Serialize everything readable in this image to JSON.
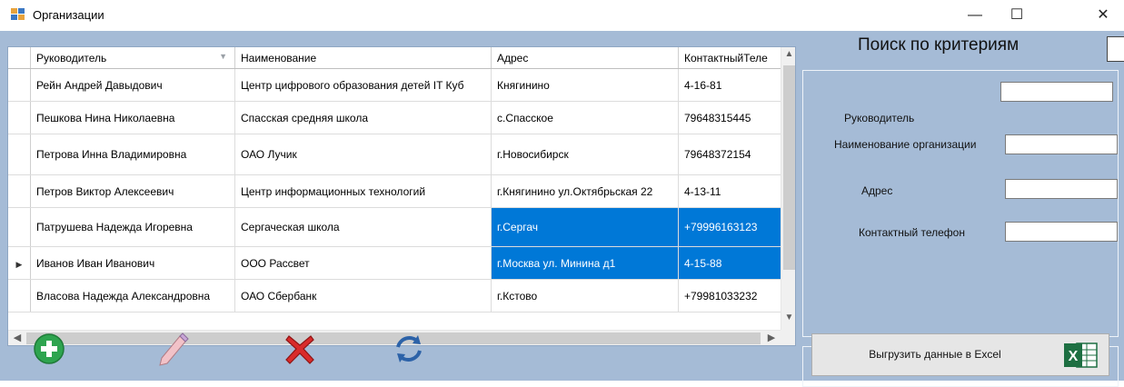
{
  "window": {
    "title": "Организации",
    "minimize": "—",
    "maximize": "☐",
    "close": "✕"
  },
  "grid": {
    "columns": [
      "Руководитель",
      "Наименование",
      "Адрес",
      "КонтактныйТеле"
    ],
    "rows": [
      {
        "cells": [
          "Рейн Андрей Давыдович",
          "Центр цифрового образования детей IT Куб",
          "Княгинино",
          "4-16-81"
        ],
        "current": false,
        "selected": false
      },
      {
        "cells": [
          "Пешкова Нина Николаевна",
          "Спасская средняя школа",
          "с.Спасское",
          "79648315445"
        ],
        "current": false,
        "selected": false
      },
      {
        "cells": [
          "Петрова Инна Владимировна",
          "ОАО Лучик",
          "г.Новосибирск",
          "79648372154"
        ],
        "current": false,
        "selected": false
      },
      {
        "cells": [
          "Петров Виктор Алексеевич",
          "Центр информационных технологий",
          "г.Княгинино ул.Октябрьская 22",
          "4-13-11"
        ],
        "current": false,
        "selected": false
      },
      {
        "cells": [
          "Патрушева Надежда Игоревна",
          "Сергаческая школа",
          "г.Сергач",
          "+79996163123"
        ],
        "current": false,
        "selected": true
      },
      {
        "cells": [
          "Иванов Иван Иванович",
          "ООО Рассвет",
          "г.Москва ул. Минина д1",
          "4-15-88"
        ],
        "current": true,
        "selected": true
      },
      {
        "cells": [
          "Власова Надежда Александровна",
          "ОАО Сбербанк",
          "г.Кстово",
          "+79981033232"
        ],
        "current": false,
        "selected": false
      }
    ]
  },
  "search": {
    "title": "Поиск по критериям",
    "fields": [
      {
        "label": "Руководитель",
        "value": ""
      },
      {
        "label": "Наименование организации",
        "value": ""
      },
      {
        "label": "Адрес",
        "value": ""
      },
      {
        "label": "Контактный телефон",
        "value": ""
      }
    ]
  },
  "export": {
    "label": "Выгрузить данные в Excel",
    "icon_text": "X"
  },
  "toolbar": {
    "add_icon": "add-icon",
    "edit_icon": "pencil-icon",
    "delete_icon": "delete-icon",
    "refresh_icon": "refresh-icon"
  },
  "colors": {
    "client_bg": "#a5bbd6",
    "selection": "#0078d7",
    "add_green": "#2ea44f",
    "delete_red": "#d92b2b",
    "excel_green": "#1d6f42"
  }
}
